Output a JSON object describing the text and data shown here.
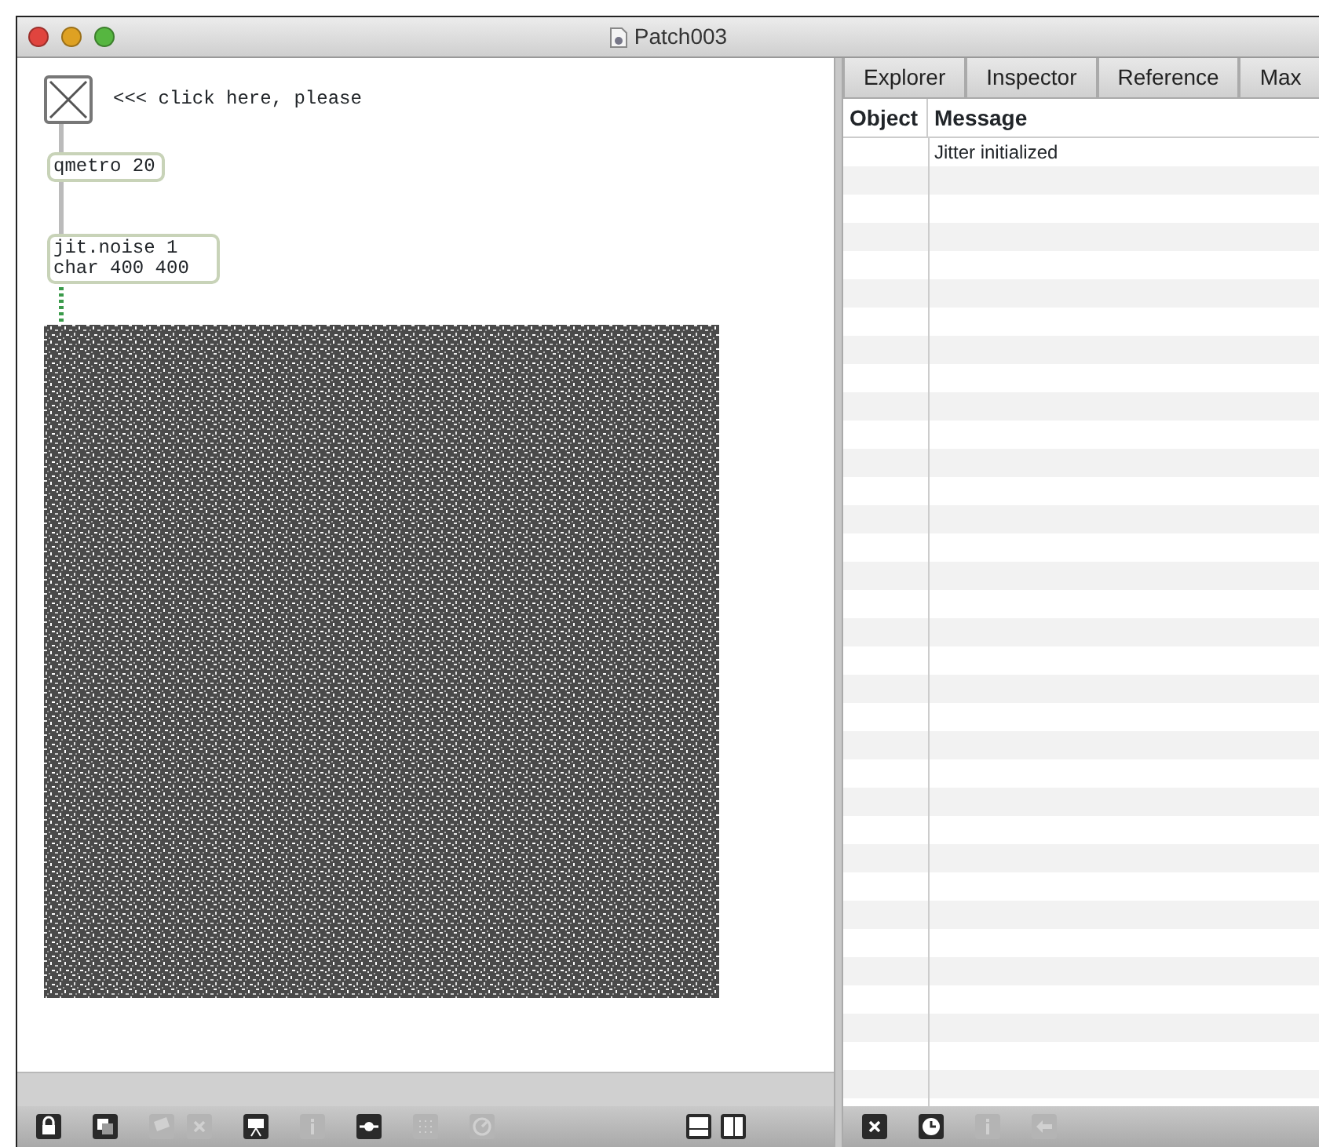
{
  "window": {
    "title": "Patch003"
  },
  "patch": {
    "toggle": {
      "checked": true
    },
    "comment": "<<< click here, please",
    "objects": [
      {
        "kind": "plain",
        "lines": [
          "qmetro 20"
        ]
      },
      {
        "kind": "plain",
        "lines": [
          "jit.noise 1",
          "char 400 400"
        ]
      }
    ]
  },
  "patch_toolbar": [
    {
      "kind": "lock",
      "disabled": false
    },
    {
      "kind": "squares",
      "disabled": false
    },
    {
      "kind": "pictures",
      "disabled": true
    },
    {
      "kind": "cross",
      "disabled": true
    },
    {
      "kind": "presentation",
      "disabled": false
    },
    {
      "kind": "info",
      "disabled": true
    },
    {
      "kind": "connect",
      "disabled": false
    },
    {
      "kind": "grid",
      "disabled": true
    },
    {
      "kind": "dial",
      "disabled": true
    },
    {
      "kind": "bottom-pane",
      "disabled": false
    },
    {
      "kind": "side-pane",
      "disabled": false
    }
  ],
  "sidebar": {
    "tabs": [
      "Explorer",
      "Inspector",
      "Reference",
      "Max"
    ],
    "columns": [
      "Object",
      "Message"
    ],
    "rows": [
      {
        "message": "Jitter initialized"
      }
    ],
    "toolbar": [
      {
        "kind": "cross",
        "disabled": false
      },
      {
        "kind": "clock",
        "disabled": false
      },
      {
        "kind": "info",
        "disabled": true
      },
      {
        "kind": "back",
        "disabled": true
      }
    ]
  }
}
